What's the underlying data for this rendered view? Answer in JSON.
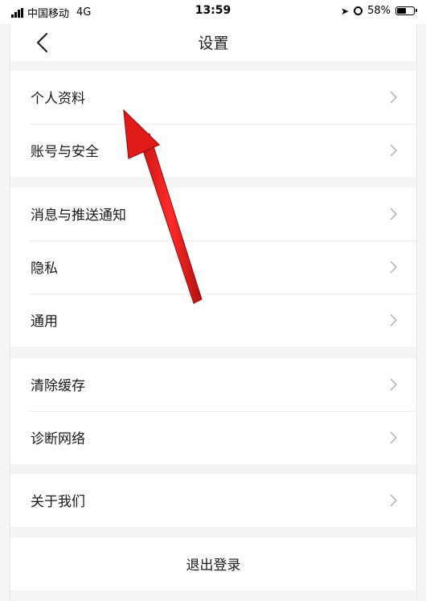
{
  "status_bar": {
    "carrier": "中国移动",
    "network": "4G",
    "time": "13:59",
    "battery_percent": "58%",
    "battery_level": 0.58,
    "icons": [
      "signal-icon",
      "location-icon",
      "alarm-icon",
      "battery-icon"
    ]
  },
  "nav": {
    "title": "设置",
    "back_icon": "chevron-left-icon"
  },
  "groups": [
    {
      "items": [
        {
          "label": "个人资料"
        },
        {
          "label": "账号与安全"
        }
      ]
    },
    {
      "items": [
        {
          "label": "消息与推送通知"
        },
        {
          "label": "隐私"
        },
        {
          "label": "通用"
        }
      ]
    },
    {
      "items": [
        {
          "label": "清除缓存"
        },
        {
          "label": "诊断网络"
        }
      ]
    },
    {
      "items": [
        {
          "label": "关于我们"
        }
      ]
    }
  ],
  "logout": {
    "label": "退出登录"
  },
  "annotation": {
    "type": "arrow",
    "color": "#e02020",
    "icon": "red-arrow-icon"
  },
  "colors": {
    "background": "#f4f4f4",
    "cell": "#ffffff",
    "text": "#1a1a1a",
    "chevron": "#b8b8b8",
    "separator": "#ececec"
  }
}
